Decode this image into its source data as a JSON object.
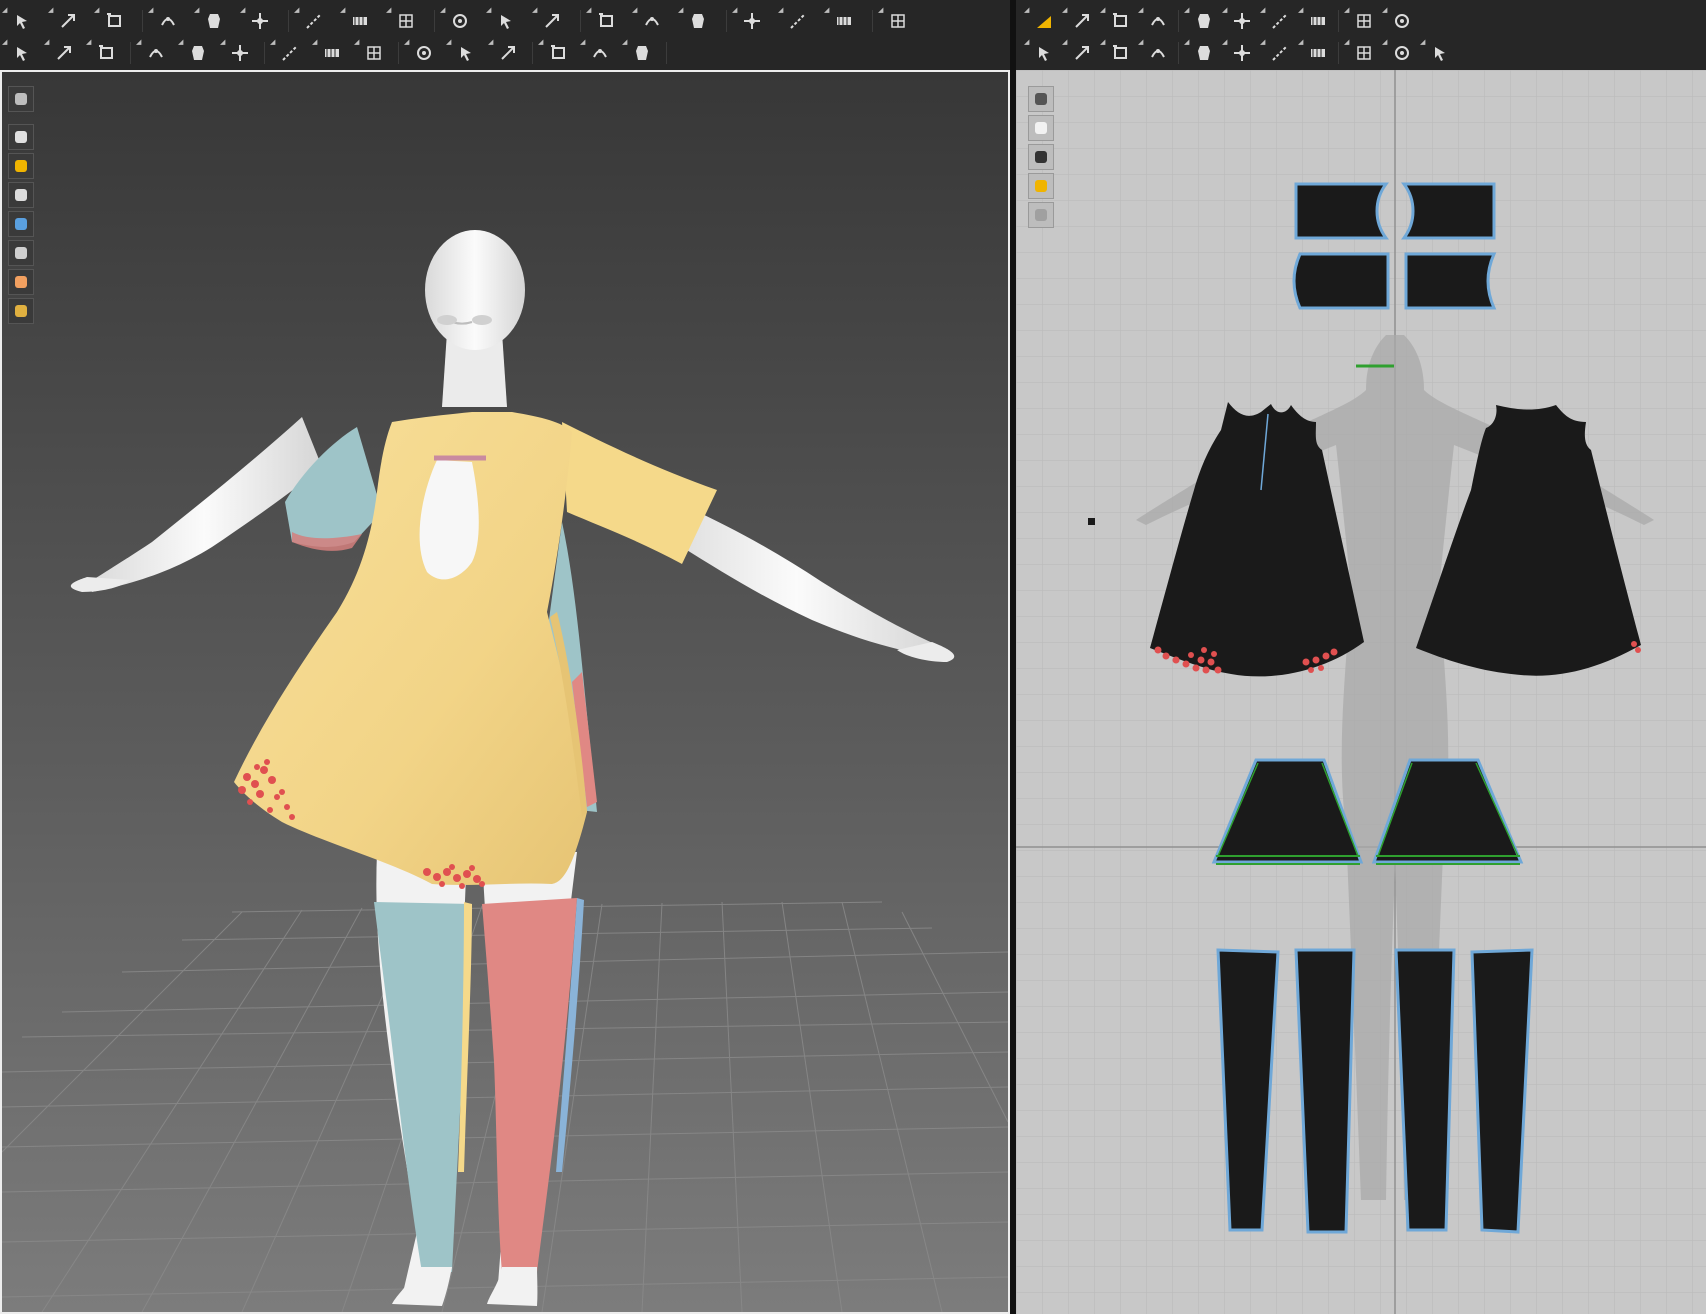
{
  "app": {
    "title": "",
    "accent": "#f0b400"
  },
  "toolbar_3d": {
    "row1": [
      "select-move-icon",
      "transform-pattern-icon",
      "edit-pattern-icon",
      "fold-arrangement-icon",
      "edit-curvature-icon",
      "edit-curve-point-icon",
      "segment-sewing-icon",
      "free-sewing-icon",
      "tack-icon",
      "edit-tack-icon",
      "pin-icon",
      "box-pin-icon",
      "arrangement-point-icon",
      "avatar-measure-icon",
      "circumference-measure-icon",
      "length-measure-icon",
      "edit-measure-icon",
      "texture-2d-icon",
      "graphic-icon"
    ],
    "row2": [
      "avatar-pose-icon",
      "select-mesh-icon",
      "steam-icon",
      "strengthen-icon",
      "shrinkage-icon",
      "fold-icon",
      "trim-icon",
      "button-icon",
      "buttonhole-icon",
      "zipper-icon",
      "puckering-icon",
      "topstitch-icon",
      "sewing-line-icon",
      "edit-sewing-icon",
      "fix-pin-icon"
    ]
  },
  "toolbar_2d": {
    "row1": [
      "transform-pattern-2d-icon",
      "edit-point-icon",
      "polygon-icon",
      "rectangle-icon",
      "internal-polygon-icon",
      "dart-icon",
      "trace-icon",
      "seam-allowance-icon",
      "texture-edit-icon",
      "graphic-edit-icon"
    ],
    "row2": [
      "segment-sew-2d-icon",
      "free-sew-2d-icon",
      "tack-2d-icon",
      "edit-sew-2d-icon",
      "iron-icon",
      "fold-2d-icon",
      "button-2d-icon",
      "buttonhole-2d-icon",
      "zipper-2d-icon",
      "measure-2d-icon",
      "ruler-icon"
    ]
  },
  "sidebar_3d": [
    "display-mode-icon",
    "garment-icon",
    "fabric-icon",
    "avatar-display-icon",
    "texture-view-icon",
    "surface-icon",
    "avatar-skin-icon",
    "world-icon"
  ],
  "sidebar_2d": [
    "pattern-line-icon",
    "garment-2d-icon",
    "info-icon",
    "fabric-2d-icon",
    "disabled-garment-icon"
  ],
  "colors": {
    "viewport_bg_top": "#3a3a3a",
    "viewport_bg_bottom": "#7a7a7a",
    "dress": "#f5d98a",
    "sleeve_left": "#9ec4c8",
    "sleeve_right": "#e08884",
    "leg_left": "#9ec4c8",
    "leg_right": "#e08884",
    "skin": "#f0f0f0",
    "pattern_fill": "#1a1a1a",
    "pattern_outline": "#6fa8d8",
    "sew_line": "#2fa02f",
    "stress": "#e05050",
    "grid_bg": "#c8c8c8"
  }
}
